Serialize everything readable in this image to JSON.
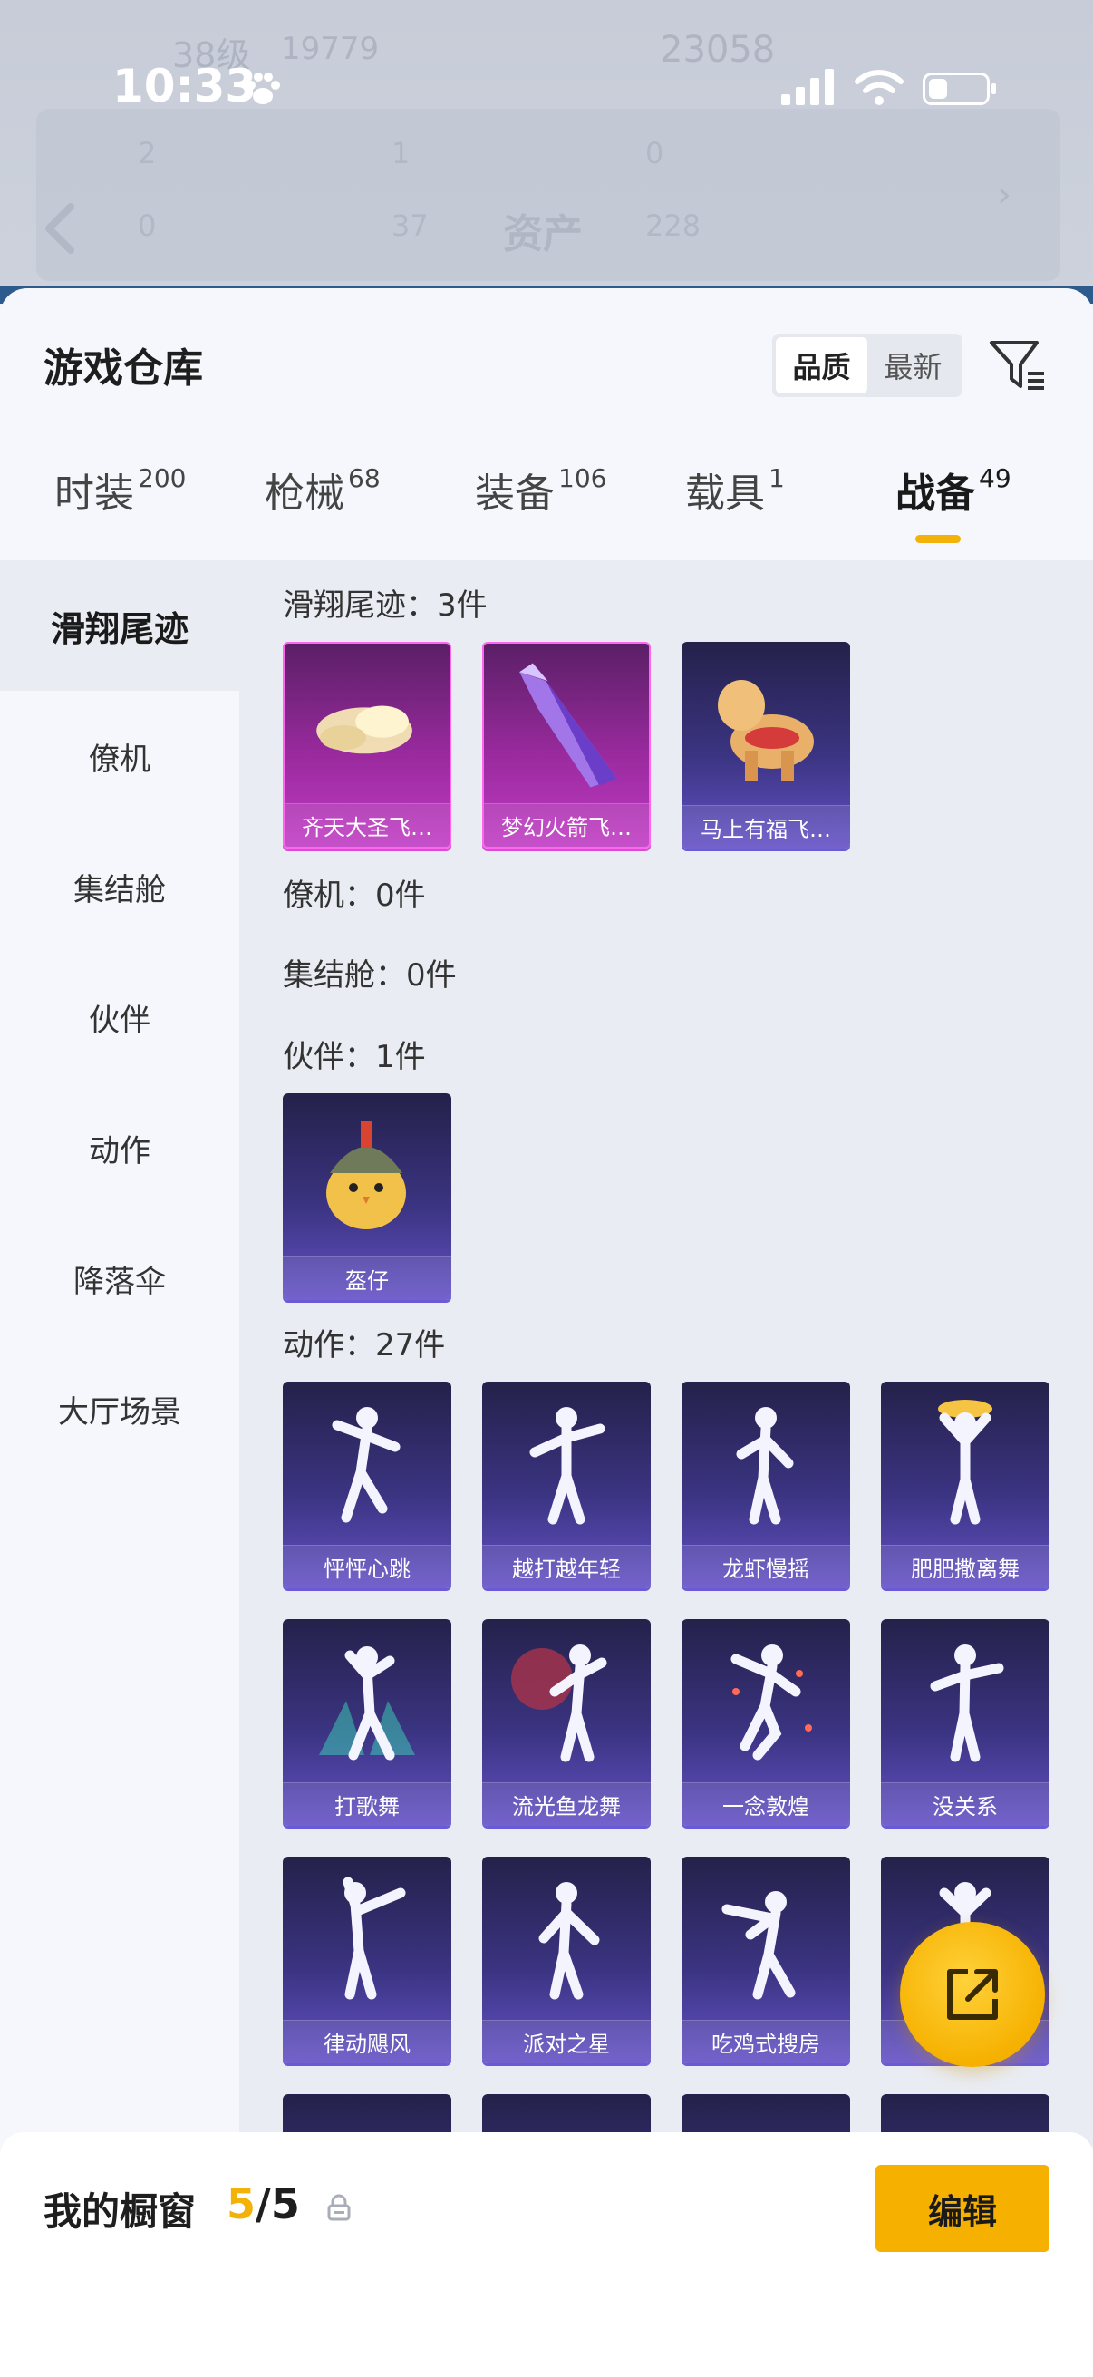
{
  "status_bar": {
    "time": "10:33"
  },
  "background": {
    "level": "38级",
    "points": "19779",
    "hot": "23058",
    "title": "资产",
    "stats": [
      "2",
      "1",
      "0",
      "0",
      "37",
      "228"
    ]
  },
  "header": {
    "title": "游戏仓库",
    "sort": {
      "options": [
        "品质",
        "最新"
      ],
      "active": "品质"
    }
  },
  "tabs": [
    {
      "label": "时装",
      "count": "200"
    },
    {
      "label": "枪械",
      "count": "68"
    },
    {
      "label": "装备",
      "count": "106"
    },
    {
      "label": "载具",
      "count": "1"
    },
    {
      "label": "战备",
      "count": "49",
      "active": true
    }
  ],
  "sidebar": {
    "items": [
      "滑翔尾迹",
      "僚机",
      "集结舱",
      "伙伴",
      "动作",
      "降落伞",
      "大厅场景"
    ],
    "active": "滑翔尾迹"
  },
  "sections": [
    {
      "title": "滑翔尾迹：3件",
      "items": [
        "齐天大圣飞…",
        "梦幻火箭飞…",
        "马上有福飞…"
      ]
    },
    {
      "title": "僚机：0件",
      "items": []
    },
    {
      "title": "集结舱：0件",
      "items": []
    },
    {
      "title": "伙伴：1件",
      "items": [
        "盔仔"
      ]
    },
    {
      "title": "动作：27件",
      "items": [
        "怦怦心跳",
        "越打越年轻",
        "龙虾慢摇",
        "肥肥撒离舞",
        "打歌舞",
        "流光鱼龙舞",
        "一念敦煌",
        "没关系",
        "律动飓风",
        "派对之星",
        "吃鸡式搜房"
      ]
    }
  ],
  "bottom_bar": {
    "label": "我的橱窗",
    "current": "5",
    "total": "/5",
    "edit_label": "编辑"
  },
  "colors": {
    "accent": "#f3b20a",
    "card_epic": "#3b3482",
    "card_legend": "#9a2a9e"
  }
}
